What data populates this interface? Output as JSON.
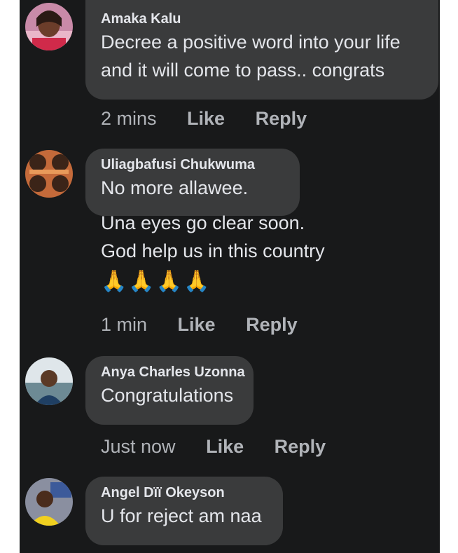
{
  "comments": [
    {
      "author": "Amaka Kalu",
      "lines": [
        "Decree a positive word into your life",
        "and it will come to pass.. congrats"
      ],
      "time": "2 mins",
      "like": "Like",
      "reply": "Reply"
    },
    {
      "author": "Uliagbafusi Chukwuma",
      "lines": [
        "No more allawee.",
        "Una eyes go clear soon.",
        "God help us in this country"
      ],
      "emoji": "🙏🙏🙏🙏",
      "time": "1 min",
      "like": "Like",
      "reply": "Reply"
    },
    {
      "author": "Anya Charles Uzonna",
      "lines": [
        "Congratulations"
      ],
      "time": "Just now",
      "like": "Like",
      "reply": "Reply"
    },
    {
      "author": "Angel Dïï Okeyson",
      "lines": [
        "U for reject am naa"
      ]
    }
  ],
  "colors": {
    "background": "#18191a",
    "bubble": "#3a3b3c",
    "text": "#e4e6eb",
    "secondary_text": "#b0b3b8"
  }
}
